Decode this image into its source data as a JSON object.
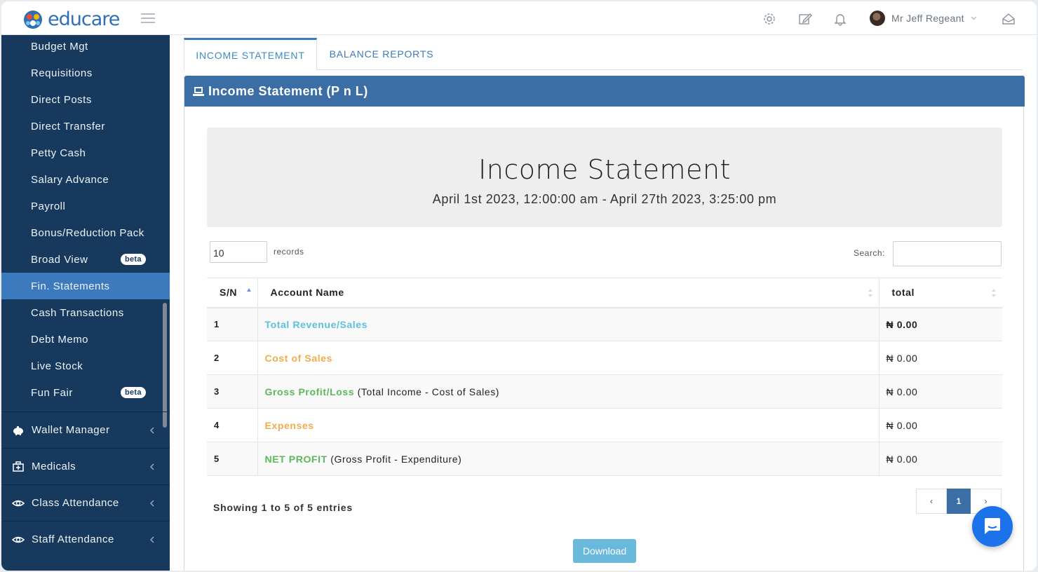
{
  "header": {
    "logo_text": "educare",
    "user_name": "Mr Jeff Regeant"
  },
  "sidebar": {
    "items": [
      {
        "label": "Budget Mgt"
      },
      {
        "label": "Requisitions"
      },
      {
        "label": "Direct Posts"
      },
      {
        "label": "Direct Transfer"
      },
      {
        "label": "Petty Cash"
      },
      {
        "label": "Salary Advance"
      },
      {
        "label": "Payroll"
      },
      {
        "label": "Bonus/Reduction Pack"
      },
      {
        "label": "Broad View",
        "badge": "beta"
      },
      {
        "label": "Fin. Statements",
        "active": true
      },
      {
        "label": "Cash Transactions"
      },
      {
        "label": "Debt Memo"
      },
      {
        "label": "Live Stock"
      },
      {
        "label": "Fun Fair",
        "badge": "beta"
      }
    ],
    "groups": [
      {
        "label": "Wallet Manager",
        "icon": "piggy-bank-icon"
      },
      {
        "label": "Medicals",
        "icon": "medical-kit-icon"
      },
      {
        "label": "Class Attendance",
        "icon": "eye-icon"
      },
      {
        "label": "Staff Attendance",
        "icon": "eye-icon"
      }
    ]
  },
  "tabs": {
    "active": "INCOME STATEMENT",
    "other": "BALANCE REPORTS"
  },
  "panel": {
    "title": "Income Statement (P n L)",
    "report_title": "Income Statement",
    "report_period": "April 1st 2023, 12:00:00 am - April 27th 2023, 3:25:00 pm"
  },
  "table_controls": {
    "page_length": "10",
    "records_label": "records",
    "search_label": "Search:"
  },
  "table": {
    "columns": [
      "S/N",
      "Account Name",
      "total"
    ],
    "rows": [
      {
        "sn": "1",
        "name": "Total Revenue/Sales",
        "note": "",
        "total": "₦ 0.00",
        "color": "#5bc0de"
      },
      {
        "sn": "2",
        "name": "Cost of Sales",
        "note": "",
        "total": "₦ 0.00",
        "color": "#f0ad4e"
      },
      {
        "sn": "3",
        "name": "Gross Profit/Loss",
        "note": "(Total Income - Cost of Sales)",
        "total": "₦ 0.00",
        "color": "#5cb85c"
      },
      {
        "sn": "4",
        "name": "Expenses",
        "note": "",
        "total": "₦ 0.00",
        "color": "#f0ad4e"
      },
      {
        "sn": "5",
        "name": "NET PROFIT",
        "note": "(Gross Profit - Expenditure)",
        "total": "₦ 0.00",
        "color": "#5cb85c"
      }
    ]
  },
  "footer": {
    "info": "Showing 1 to 5 of 5 entries",
    "pager": {
      "prev": "‹",
      "current": "1",
      "next": "›"
    },
    "download_label": "Download"
  },
  "colors": {
    "sidebar_bg": "#17395e",
    "active_item": "#3c79bd",
    "panel_header": "#3a6ea5",
    "chat_button": "#1c72e8"
  }
}
